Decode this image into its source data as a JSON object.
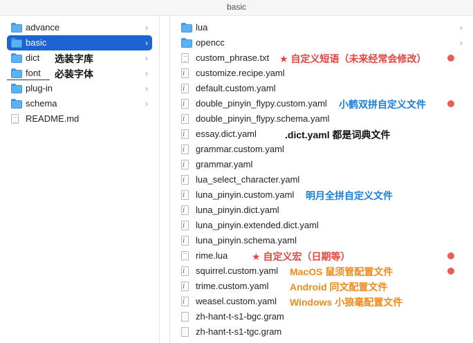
{
  "window": {
    "title": "basic"
  },
  "left_column": {
    "items": [
      {
        "label": "advance",
        "type": "folder",
        "has_chevron": true,
        "selected": false
      },
      {
        "label": "basic",
        "type": "folder",
        "has_chevron": true,
        "selected": true
      },
      {
        "label": "dict",
        "type": "folder",
        "has_chevron": true,
        "selected": false
      },
      {
        "label": "font",
        "type": "folder",
        "has_chevron": true,
        "selected": false
      },
      {
        "label": "plug-in",
        "type": "folder",
        "has_chevron": true,
        "selected": false
      },
      {
        "label": "schema",
        "type": "folder",
        "has_chevron": true,
        "selected": false
      },
      {
        "label": "README.md",
        "type": "file",
        "has_chevron": false,
        "selected": false
      }
    ],
    "chevron": "›"
  },
  "right_column": {
    "items": [
      {
        "label": "lua",
        "type": "folder",
        "icon": "folder-icon"
      },
      {
        "label": "opencc",
        "type": "folder",
        "icon": "folder-icon"
      },
      {
        "label": "custom_phrase.txt",
        "type": "file",
        "icon": "text-file-icon"
      },
      {
        "label": "customize.recipe.yaml",
        "type": "file",
        "icon": "yaml-file-icon"
      },
      {
        "label": "default.custom.yaml",
        "type": "file",
        "icon": "yaml-file-icon"
      },
      {
        "label": "double_pinyin_flypy.custom.yaml",
        "type": "file",
        "icon": "yaml-file-icon"
      },
      {
        "label": "double_pinyin_flypy.schema.yaml",
        "type": "file",
        "icon": "yaml-file-icon"
      },
      {
        "label": "essay.dict.yaml",
        "type": "file",
        "icon": "yaml-file-icon"
      },
      {
        "label": "grammar.custom.yaml",
        "type": "file",
        "icon": "yaml-file-icon"
      },
      {
        "label": "grammar.yaml",
        "type": "file",
        "icon": "yaml-file-icon"
      },
      {
        "label": "lua_select_character.yaml",
        "type": "file",
        "icon": "yaml-file-icon"
      },
      {
        "label": "luna_pinyin.custom.yaml",
        "type": "file",
        "icon": "yaml-file-icon"
      },
      {
        "label": "luna_pinyin.dict.yaml",
        "type": "file",
        "icon": "yaml-file-icon"
      },
      {
        "label": "luna_pinyin.extended.dict.yaml",
        "type": "file",
        "icon": "yaml-file-icon"
      },
      {
        "label": "luna_pinyin.schema.yaml",
        "type": "file",
        "icon": "yaml-file-icon"
      },
      {
        "label": "rime.lua",
        "type": "file",
        "icon": "lua-file-icon"
      },
      {
        "label": "squirrel.custom.yaml",
        "type": "file",
        "icon": "yaml-file-icon"
      },
      {
        "label": "trime.custom.yaml",
        "type": "file",
        "icon": "yaml-file-icon"
      },
      {
        "label": "weasel.custom.yaml",
        "type": "file",
        "icon": "yaml-file-icon"
      },
      {
        "label": "zh-hant-t-s1-bgc.gram",
        "type": "file",
        "icon": "blank-file-icon"
      },
      {
        "label": "zh-hant-t-s1-tgc.gram",
        "type": "file",
        "icon": "blank-file-icon"
      }
    ],
    "chevron": "›"
  },
  "annotations": {
    "dict_note": "选装字库",
    "font_note": "必装字体",
    "custom_phrase_note": "★ 自定义短语（未来经常会修改）",
    "flypy_note": "小鹤双拼自定义文件",
    "dict_yaml_note": ".dict.yaml 都是词典文件",
    "luna_note": "明月全拼自定义文件",
    "rime_lua_note": "★ 自定义宏（日期等）",
    "squirrel_note": "MacOS 鼠须管配置文件",
    "trime_note": "Android 同文配置文件",
    "weasel_note": "Windows  小狼毫配置文件"
  },
  "colors": {
    "selection": "#1e63d2",
    "folder": "#5cb1f2",
    "red_tag": "#ec5b55",
    "annotation_red": "#e8443f",
    "annotation_blue": "#1a7ee0",
    "annotation_orange": "#f08a1a"
  }
}
